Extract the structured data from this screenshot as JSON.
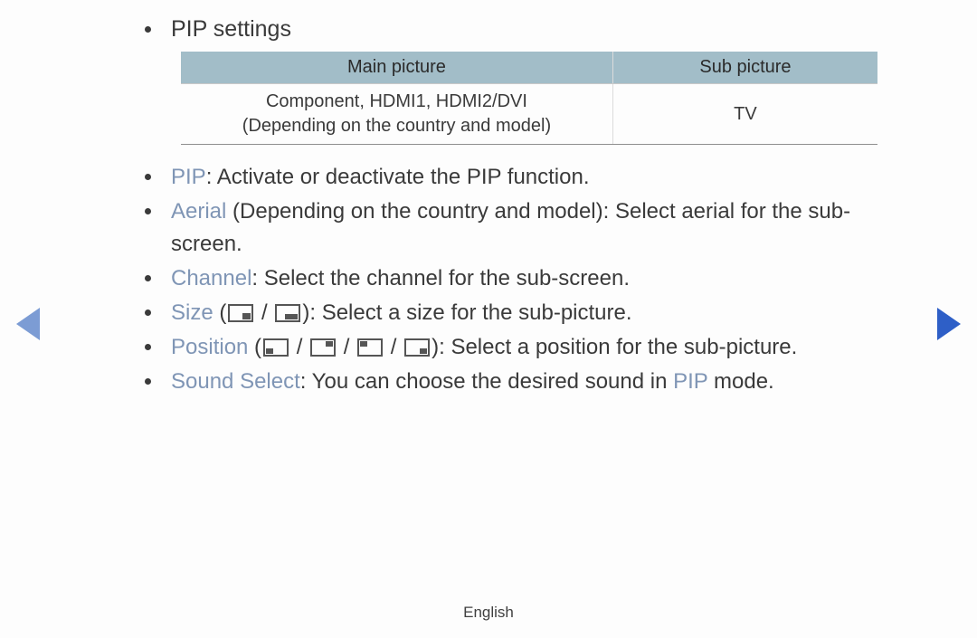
{
  "heading": "PIP settings",
  "table": {
    "headers": [
      "Main picture",
      "Sub picture"
    ],
    "row": {
      "main_line1": "Component, HDMI1, HDMI2/DVI",
      "main_line2": "(Depending on the country and model)",
      "sub": "TV"
    }
  },
  "items": {
    "pip": {
      "term": "PIP",
      "desc": ": Activate or deactivate the PIP function."
    },
    "aerial": {
      "term": "Aerial",
      "desc_pre": " (Depending on the country and model): Select aerial for the sub-screen."
    },
    "channel": {
      "term": "Channel",
      "desc": ": Select the channel for the sub-screen."
    },
    "size": {
      "term": "Size",
      "open": " (",
      "sep": " / ",
      "close": "): Select a size for the sub-picture."
    },
    "position": {
      "term": "Position",
      "open": " (",
      "sep": " / ",
      "close": "): Select a position for the sub-picture."
    },
    "sound": {
      "term": "Sound Select",
      "desc_pre": ": You can choose the desired sound in ",
      "pip_word": "PIP",
      "desc_post": " mode."
    }
  },
  "footer": "English"
}
